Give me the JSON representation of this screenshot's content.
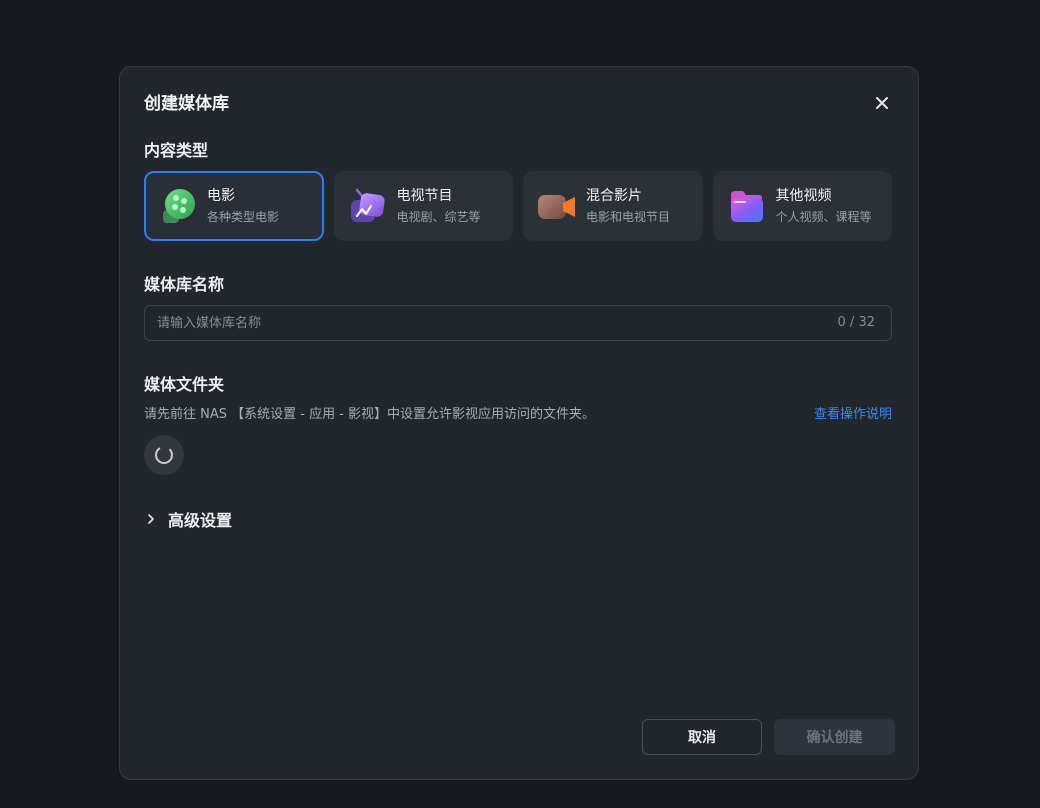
{
  "dialog": {
    "title": "创建媒体库",
    "close_icon": "close-icon"
  },
  "content_type": {
    "label": "内容类型",
    "selected": "电影",
    "options": [
      {
        "title": "电影",
        "desc": "各种类型电影",
        "icon": "film-reel-icon"
      },
      {
        "title": "电视节目",
        "desc": "电视剧、综艺等",
        "icon": "tv-icon"
      },
      {
        "title": "混合影片",
        "desc": "电影和电视节目",
        "icon": "video-camera-icon"
      },
      {
        "title": "其他视频",
        "desc": "个人视频、课程等",
        "icon": "folder-icon"
      }
    ]
  },
  "library_name": {
    "label": "媒体库名称",
    "value": "",
    "placeholder": "请输入媒体库名称",
    "counter": "0 / 32"
  },
  "media_folder": {
    "label": "媒体文件夹",
    "hint": "请先前往 NAS 【系统设置 - 应用 - 影视】中设置允许影视应用访问的文件夹。",
    "help_link": "查看操作说明",
    "loading_icon": "spinner-icon"
  },
  "advanced": {
    "label": "高级设置",
    "icon": "chevron-right-icon"
  },
  "footer": {
    "cancel_label": "取消",
    "confirm_label": "确认创建"
  },
  "colors": {
    "accent": "#2f7cf6",
    "link": "#3b8bf5",
    "dialog_bg": "#22262d",
    "page_bg": "#16191d"
  }
}
